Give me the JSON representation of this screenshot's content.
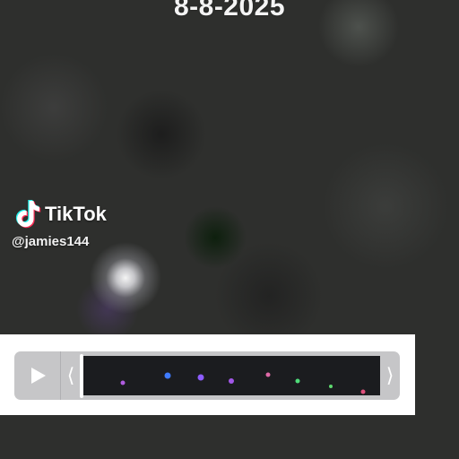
{
  "overlay": {
    "date_text": "8-8-2025"
  },
  "watermark": {
    "brand": "TikTok",
    "handle": "@jamies144",
    "logo_icon": "tiktok-logo-icon"
  },
  "video_controls": {
    "play_icon": "play-icon",
    "trim_left_icon": "trim-handle-left-icon",
    "trim_right_icon": "trim-handle-right-icon",
    "trim_left_glyph": "⟨",
    "trim_right_glyph": "⟩",
    "playhead_position": 0.0
  },
  "colors": {
    "panel_background": "#ffffff",
    "scrubber_background": "#c6c6c8",
    "filmstrip_background": "#1b1c1f",
    "frame_lights": [
      "#b05ce0",
      "#3f7bff",
      "#8d5cff",
      "#a257e8",
      "#e06aa8",
      "#4fdc79",
      "#5ed86e",
      "#e0507c"
    ]
  }
}
